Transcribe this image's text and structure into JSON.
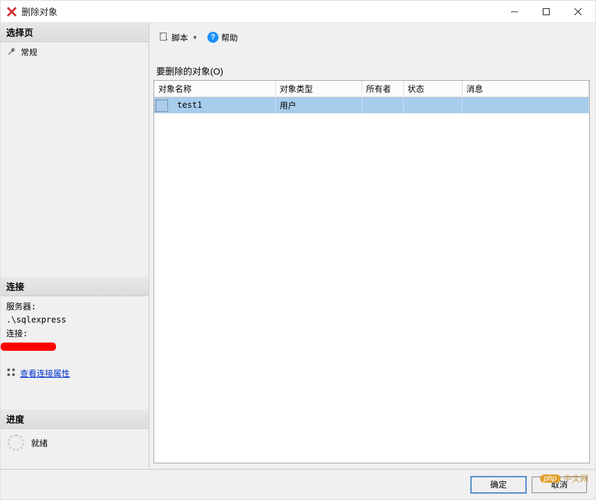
{
  "window": {
    "title": "删除对象"
  },
  "sidebar": {
    "select_page_header": "选择页",
    "general_item": "常规",
    "connection_header": "连接",
    "server_label": "服务器:",
    "server_value": ".\\sqlexpress",
    "conn_label": "连接:",
    "view_props": "查看连接属性",
    "progress_header": "进度",
    "progress_status": "就绪"
  },
  "toolbar": {
    "script_label": "脚本",
    "help_label": "帮助"
  },
  "main": {
    "objects_to_delete_label": "要删除的对象(O)",
    "columns": {
      "name": "对象名称",
      "type": "对象类型",
      "owner": "所有者",
      "status": "状态",
      "message": "消息"
    },
    "rows": [
      {
        "name": "test1",
        "type": "用户",
        "owner": "",
        "status": "",
        "message": ""
      }
    ]
  },
  "footer": {
    "ok": "确定",
    "cancel": "取消"
  },
  "watermark": {
    "badge": "php",
    "text": "中文网"
  }
}
